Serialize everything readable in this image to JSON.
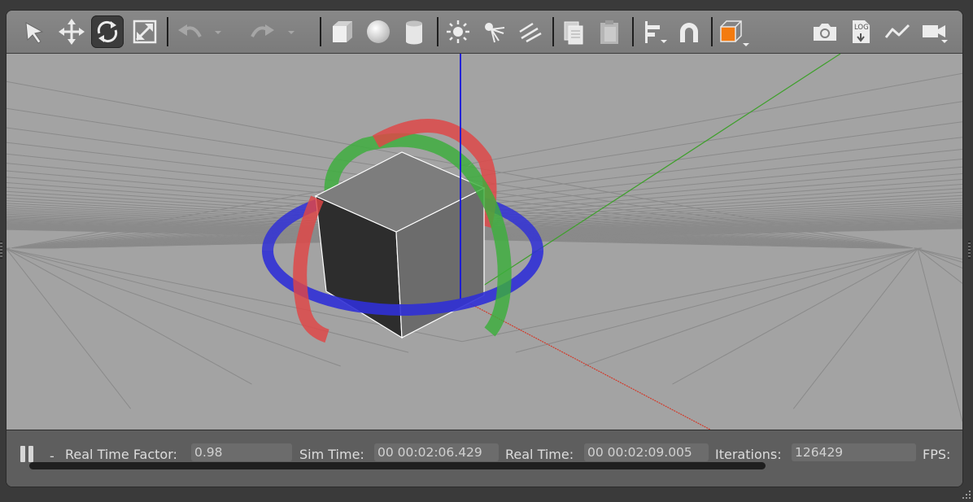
{
  "toolbar": {
    "tools": [
      {
        "name": "select-mode",
        "icon": "arrow-cursor-icon"
      },
      {
        "name": "translate-mode",
        "icon": "move-arrows-icon"
      },
      {
        "name": "rotate-mode",
        "icon": "rotate-icon",
        "active": true
      },
      {
        "name": "scale-mode",
        "icon": "scale-icon"
      },
      {
        "name": "undo",
        "icon": "undo-icon"
      },
      {
        "name": "redo",
        "icon": "redo-icon"
      },
      {
        "name": "insert-box",
        "icon": "box-icon"
      },
      {
        "name": "insert-sphere",
        "icon": "sphere-icon"
      },
      {
        "name": "insert-cylinder",
        "icon": "cylinder-icon"
      },
      {
        "name": "point-light",
        "icon": "point-light-icon"
      },
      {
        "name": "spot-light",
        "icon": "spot-light-icon"
      },
      {
        "name": "directional-light",
        "icon": "directional-light-icon"
      },
      {
        "name": "copy",
        "icon": "copy-icon"
      },
      {
        "name": "paste",
        "icon": "paste-icon"
      },
      {
        "name": "align",
        "icon": "align-icon"
      },
      {
        "name": "snap",
        "icon": "magnet-icon"
      },
      {
        "name": "view-angle",
        "icon": "view-cube-icon"
      },
      {
        "name": "screenshot",
        "icon": "camera-icon"
      },
      {
        "name": "log",
        "icon": "log-icon",
        "text": "LOG"
      },
      {
        "name": "plot",
        "icon": "plot-icon"
      },
      {
        "name": "record-video",
        "icon": "video-camera-icon"
      }
    ]
  },
  "statusbar": {
    "dash": "-",
    "real_time_factor_label": "Real Time Factor:",
    "real_time_factor_value": "0.98",
    "sim_time_label": "Sim Time:",
    "sim_time_value": "00 00:02:06.429",
    "real_time_label": "Real Time:",
    "real_time_value": "00 00:02:09.005",
    "iterations_label": "Iterations:",
    "iterations_value": "126429",
    "fps_label": "FPS:"
  },
  "colors": {
    "toolbar_bg": "#808080",
    "viewport_bg": "#a3a3a3",
    "grid_line": "#8a8a8a",
    "axis_x": "#d23a2a",
    "axis_y": "#3fa02c",
    "axis_z": "#1010d0",
    "ring_x": "#e04646",
    "ring_y": "#3caf3c",
    "ring_z": "#3030d6",
    "accent_orange": "#f47b0e",
    "statusbar_bg": "#5e5e5e"
  }
}
